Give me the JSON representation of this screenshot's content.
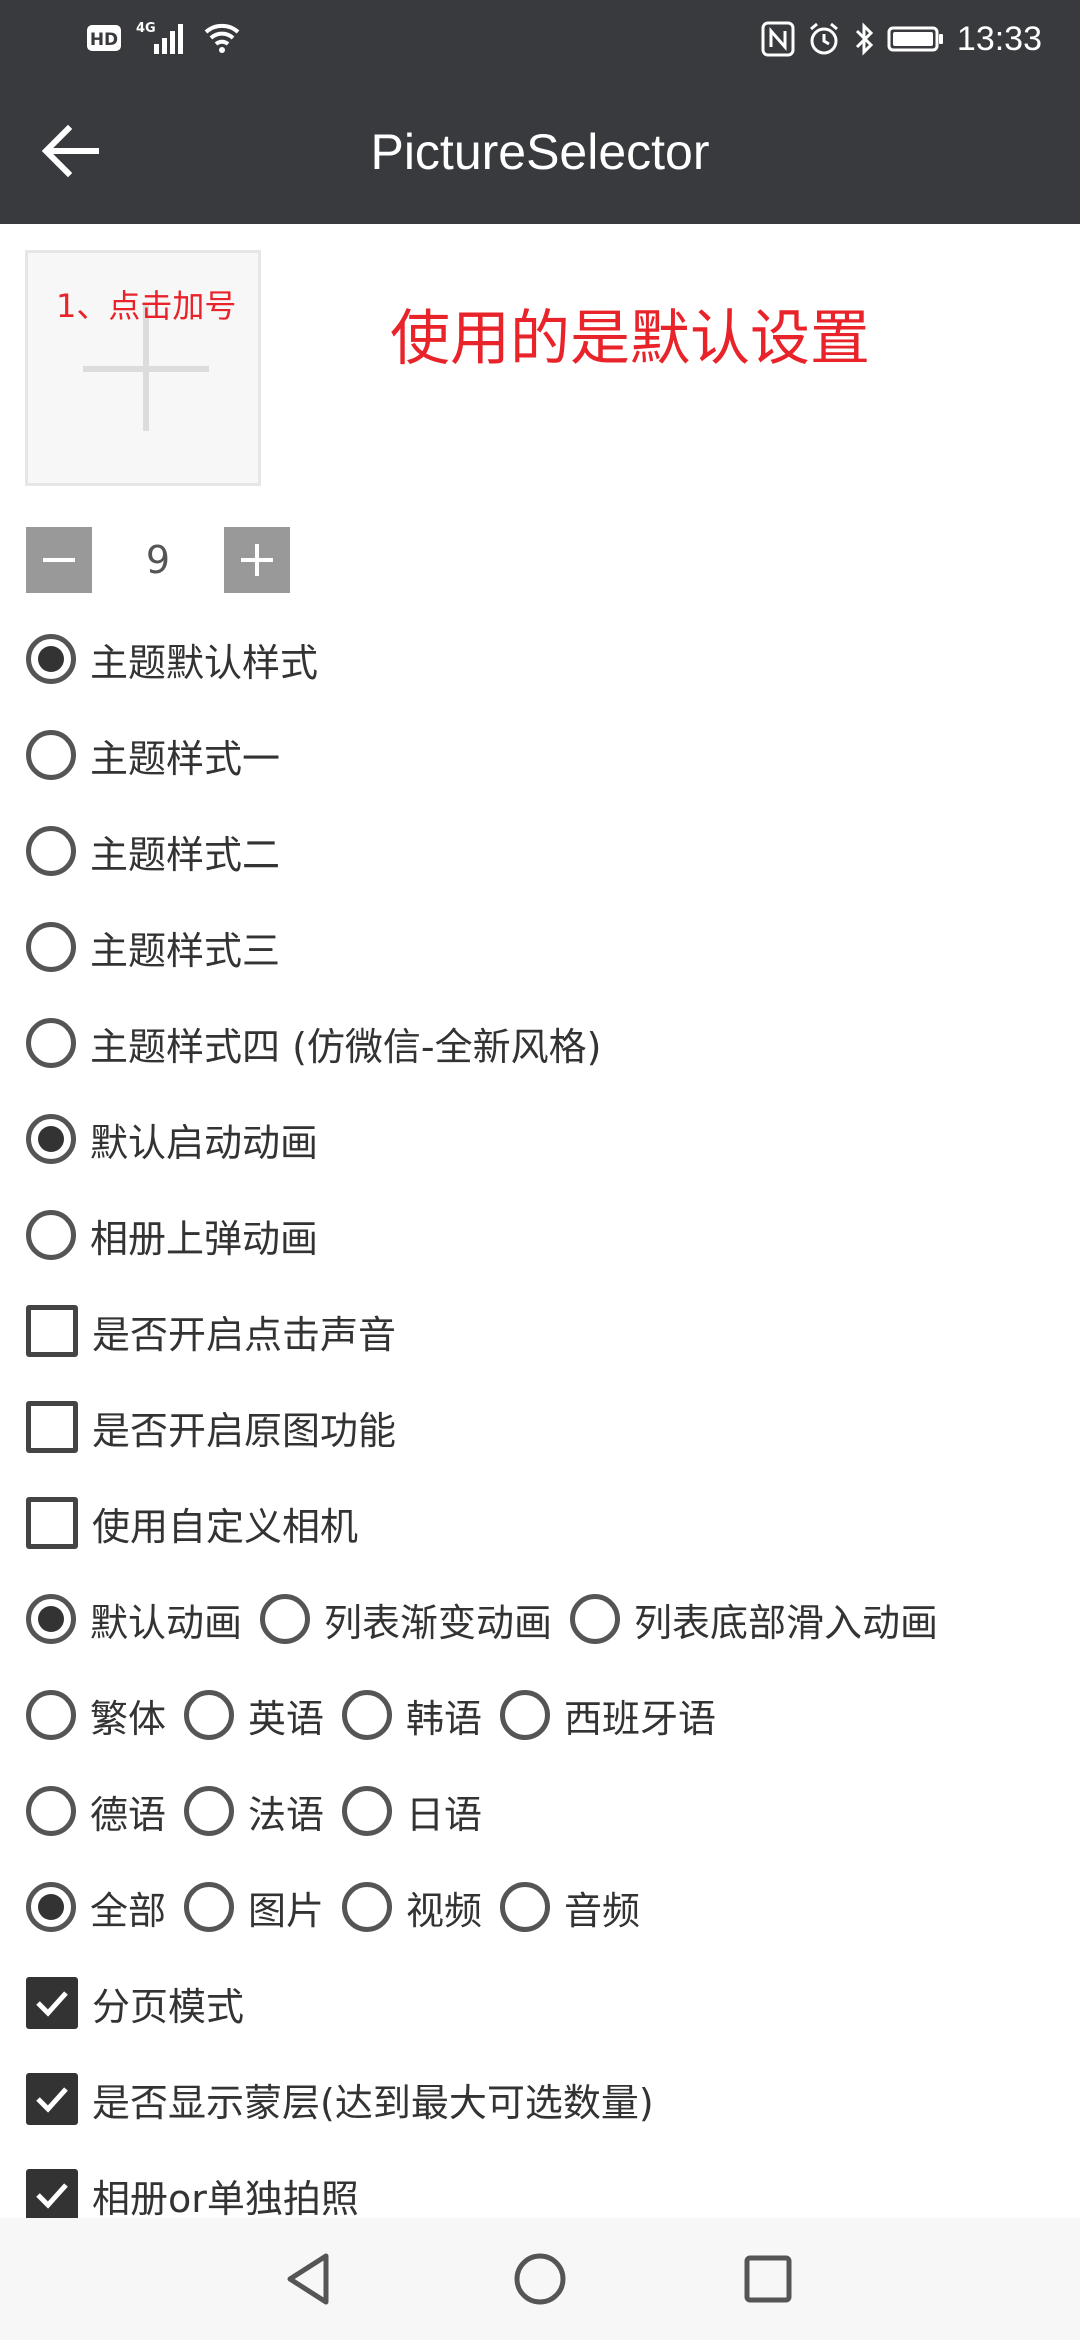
{
  "status_bar": {
    "left_icons": [
      "hd-icon",
      "signal-4g-icon",
      "wifi-icon"
    ],
    "hd_label": "HD",
    "network_label": "4G",
    "right_icons": [
      "nfc-icon",
      "alarm-icon",
      "bluetooth-icon",
      "battery-icon"
    ],
    "time": "13:33"
  },
  "toolbar": {
    "title": "PictureSelector",
    "back_icon": "arrow-left-icon"
  },
  "add_picture": {
    "hint": "1、点击加号",
    "icon": "plus-icon"
  },
  "banner_text": "使用的是默认设置",
  "max_select": {
    "value": "9",
    "minus_icon": "minus-icon",
    "plus_icon": "plus-icon"
  },
  "options": {
    "theme_default": "主题默认样式",
    "theme_1": "主题样式一",
    "theme_2": "主题样式二",
    "theme_3": "主题样式三",
    "theme_4": "主题样式四 (仿微信-全新风格)",
    "anim_default": "默认启动动画",
    "anim_album_up": "相册上弹动画",
    "click_sound": "是否开启点击声音",
    "original_image": "是否开启原图功能",
    "custom_camera": "使用自定义相机",
    "list_anim_default": "默认动画",
    "list_anim_fade": "列表渐变动画",
    "list_anim_slide": "列表底部滑入动画",
    "lang_traditional": "繁体",
    "lang_english": "英语",
    "lang_korean": "韩语",
    "lang_spanish": "西班牙语",
    "lang_german": "德语",
    "lang_french": "法语",
    "lang_japanese": "日语",
    "type_all": "全部",
    "type_image": "图片",
    "type_video": "视频",
    "type_audio": "音频",
    "paging_mode": "分页模式",
    "show_mask": "是否显示蒙层(达到最大可选数量)",
    "album_or_camera": "相册or单独拍照"
  },
  "nav_bar": {
    "back": "triangle-back-icon",
    "home": "circle-home-icon",
    "recents": "square-recents-icon"
  }
}
